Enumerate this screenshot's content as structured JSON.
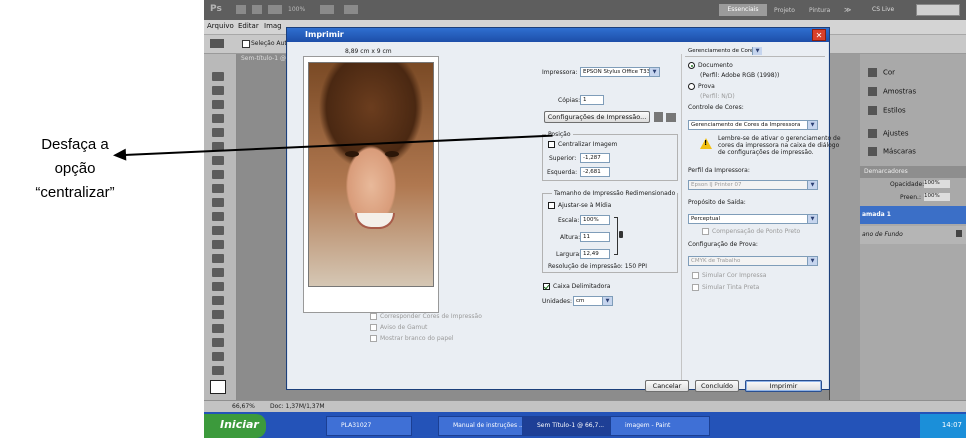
{
  "annotation": {
    "line1": "Desfaça a",
    "line2": "opção",
    "line3": "“centralizar”"
  },
  "ps": {
    "logo": "Ps",
    "zoom_menu": "100%",
    "workspaces": [
      "Essenciais",
      "Projeto",
      "Pintura"
    ],
    "more": "≫",
    "cslive": "CS Live",
    "menu": [
      "Arquivo",
      "Editar",
      "Imag"
    ],
    "options_sel": "Seleção Auto",
    "doc_tab": "Sem-título-1 @",
    "panels": [
      "Cor",
      "Amostras",
      "Estilos",
      "Ajustes",
      "Máscaras"
    ],
    "layers_tabs": [
      "Demarcadores"
    ],
    "opacity_label": "Opacidade:",
    "opacity_value": "100%",
    "fill_label": "Preen.:",
    "fill_value": "100%",
    "layer1": "amada 1",
    "layer2": "ano de Fundo",
    "status_zoom": "66,67%",
    "status_doc": "Doc: 1,37M/1,37M"
  },
  "taskbar": {
    "start": "Iniciar",
    "tasks": [
      "PLA31027",
      "Manual de instruções ...",
      "Sem Título-1 @ 66,7...",
      "imagem - Paint"
    ],
    "clock": "14:07"
  },
  "dialog": {
    "title": "Imprimir",
    "close": "✕",
    "paper_size": "8,89 cm x 9 cm",
    "printer_label": "Impressora:",
    "printer_value": "EPSON Stylus Office T33 ...",
    "copies_label": "Cópias:",
    "copies_value": "1",
    "print_settings_btn": "Configurações de Impressão...",
    "position_group": "Posição",
    "center_image": "Centralizar Imagem",
    "top_label": "Superior:",
    "top_value": "-1,287",
    "left_label": "Esquerda:",
    "left_value": "-2,681",
    "scaled_group": "Tamanho de Impressão Redimensionado",
    "fit_media": "Ajustar-se à Mídia",
    "scale_label": "Escala:",
    "scale_value": "100%",
    "height_label": "Altura:",
    "height_value": "11",
    "width_label": "Largura:",
    "width_value": "12,49",
    "resolution": "Resolução de impressão: 150 PPI",
    "bounding_box": "Caixa Delimitadora",
    "units_label": "Unidades:",
    "units_value": "cm",
    "match_colors": "Corresponder Cores de Impressão",
    "gamut_warning": "Aviso de Gamut",
    "paper_white": "Mostrar branco do papel",
    "color_mgmt_value": "Gerenciamento de Cores",
    "document_label": "Documento",
    "document_profile": "(Perfil: Adobe RGB (1998))",
    "proof_label": "Prova",
    "proof_profile": "(Perfil: N/D)",
    "color_handling_label": "Controle de Cores:",
    "color_handling_value": "Gerenciamento de Cores da Impressora",
    "warning_text_1": "Lembre-se de ativar o gerenciamento de",
    "warning_text_2": "cores da impressora na caixa de diálogo",
    "warning_text_3": "de configurações de impressão.",
    "printer_profile_label": "Perfil da Impressora:",
    "printer_profile_value": "Epson IJ Printer 07",
    "rendering_label": "Propósito de Saída:",
    "rendering_value": "Perceptual",
    "black_point": "Compensação de Ponto Preto",
    "proof_setup_label": "Configuração de Prova:",
    "proof_setup_value": "CMYK de Trabalho",
    "sim_paper": "Simular Cor Impressa",
    "sim_ink": "Simular Tinta Preta",
    "cancel": "Cancelar",
    "done": "Concluído",
    "print": "Imprimir"
  }
}
